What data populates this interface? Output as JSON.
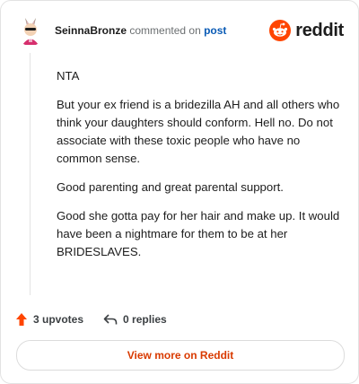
{
  "header": {
    "username": "SeinnaBronze",
    "action": "commented on",
    "post_link": "post",
    "logo_text": "reddit",
    "avatar_icon": "user-avatar-icon",
    "logo_icon": "reddit-snoo-icon"
  },
  "comment": {
    "paragraphs": [
      "NTA",
      "But your ex friend is a bridezilla AH and all others who think your daughters should conform. Hell no. Do not associate with these toxic people who have no common sense.",
      "Good parenting and great parental support.",
      "Good she gotta pay for her hair and make up. It would have been a nightmare for them to be at her BRIDESLAVES."
    ]
  },
  "footer": {
    "upvotes_label": "3 upvotes",
    "replies_label": "0 replies",
    "view_more_label": "View more on Reddit"
  },
  "colors": {
    "brand": "#ff4500",
    "link": "#0a5bb5",
    "view_more_text": "#d93a00"
  }
}
